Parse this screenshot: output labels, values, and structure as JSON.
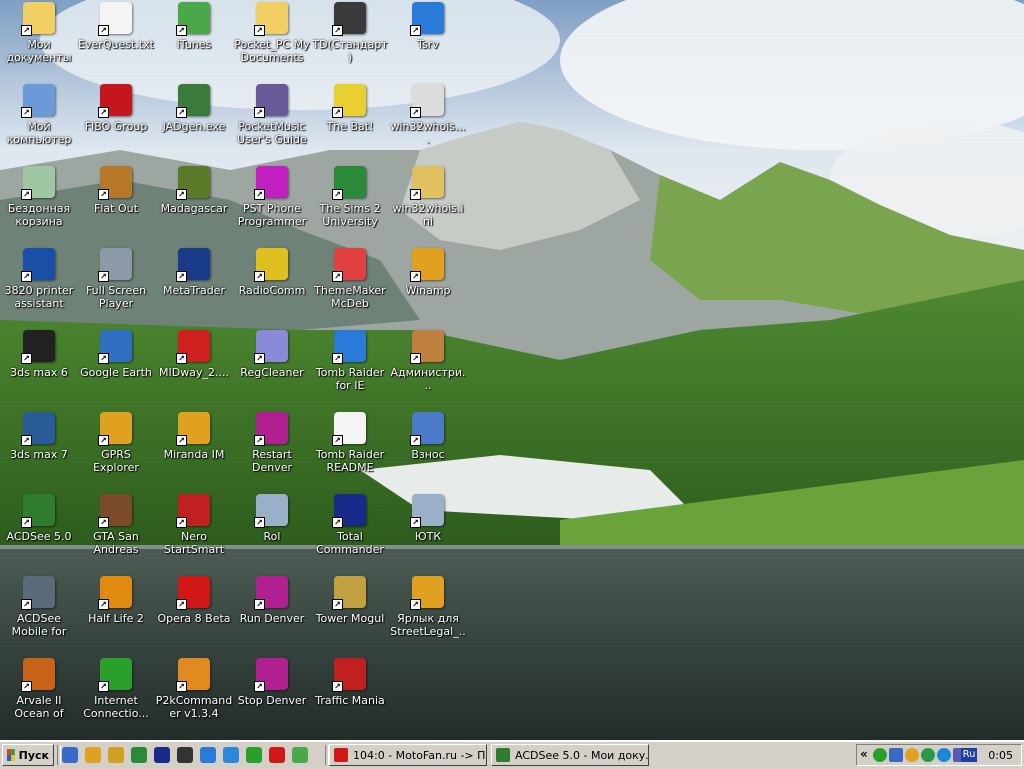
{
  "desktop": {
    "icons": [
      {
        "label": "Мои документы",
        "icon": "my-documents-icon",
        "color": "#f2cf62"
      },
      {
        "label": "Мой компьютер",
        "icon": "my-computer-icon",
        "color": "#6a9ad8"
      },
      {
        "label": "Бездонная корзина",
        "icon": "recycle-bin-icon",
        "color": "#9fc7a3"
      },
      {
        "label": "3820 printer assistant",
        "icon": "hp-printer-icon",
        "color": "#1a4fa8"
      },
      {
        "label": "3ds max 6",
        "icon": "3dsmax-icon",
        "color": "#222222"
      },
      {
        "label": "3ds max 7",
        "icon": "3dsmax-icon",
        "color": "#2a5b99"
      },
      {
        "label": "ACDSee 5.0",
        "icon": "acdsee-icon",
        "color": "#2f7b2f"
      },
      {
        "label": "ACDSee Mobile for Windows...",
        "icon": "acdsee-mobile-icon",
        "color": "#5a6b7a"
      },
      {
        "label": "Arvale II Ocean of Time",
        "icon": "game-icon",
        "color": "#c7641a"
      },
      {
        "label": "EverQuest.txt",
        "icon": "text-file-icon",
        "color": "#f4f4f4"
      },
      {
        "label": "FIBO Group",
        "icon": "fibo-icon",
        "color": "#c4161c"
      },
      {
        "label": "Flat Out",
        "icon": "flatout-icon",
        "color": "#b8782a"
      },
      {
        "label": "Full Screen Player",
        "icon": "media-player-icon",
        "color": "#8c9aa8"
      },
      {
        "label": "Google Earth",
        "icon": "globe-icon",
        "color": "#2f6fc4"
      },
      {
        "label": "GPRS Explorer",
        "icon": "phone-icon",
        "color": "#e0a020"
      },
      {
        "label": "GTA San Andreas",
        "icon": "game-icon",
        "color": "#7a4a2a"
      },
      {
        "label": "Half Life 2",
        "icon": "halflife-icon",
        "color": "#e08a10"
      },
      {
        "label": "Internet Connectio...",
        "icon": "network-icon",
        "color": "#2aa02a"
      },
      {
        "label": "iTunes",
        "icon": "itunes-icon",
        "color": "#4aa84a"
      },
      {
        "label": "JADgen.exe",
        "icon": "exe-icon",
        "color": "#3a7a3a"
      },
      {
        "label": "Madagascar",
        "icon": "game-icon",
        "color": "#5a7a2a"
      },
      {
        "label": "MetaTrader",
        "icon": "chart-icon",
        "color": "#1a3a8a"
      },
      {
        "label": "MIDway_2....",
        "icon": "arrows-icon",
        "color": "#d02020"
      },
      {
        "label": "Miranda IM",
        "icon": "miranda-icon",
        "color": "#e0a020"
      },
      {
        "label": "Nero StartSmart",
        "icon": "nero-icon",
        "color": "#c02020"
      },
      {
        "label": "Opera 8 Beta",
        "icon": "opera-icon",
        "color": "#d01818"
      },
      {
        "label": "P2kCommander v1.3.4",
        "icon": "gear-icon",
        "color": "#e08a20"
      },
      {
        "label": "Pocket_PC My Documents",
        "icon": "folder-icon",
        "color": "#f2cf62"
      },
      {
        "label": "PocketMusic User's Guide",
        "icon": "help-icon",
        "color": "#6a5a9a"
      },
      {
        "label": "PST Phone Programmer",
        "icon": "tetris-icon",
        "color": "#c020c0"
      },
      {
        "label": "RadioComm",
        "icon": "radio-icon",
        "color": "#e0c020"
      },
      {
        "label": "RegCleaner",
        "icon": "cleaner-icon",
        "color": "#8a8ad8"
      },
      {
        "label": "Restart Denver",
        "icon": "denver-icon",
        "color": "#b02090"
      },
      {
        "label": "Rol",
        "icon": "network-icon",
        "color": "#9ab0c8"
      },
      {
        "label": "Run Denver",
        "icon": "denver-icon",
        "color": "#b02090"
      },
      {
        "label": "Stop Denver",
        "icon": "denver-icon",
        "color": "#b02090"
      },
      {
        "label": "TD(Стандарт)",
        "icon": "terminal-icon",
        "color": "#3a3a3a"
      },
      {
        "label": "The Bat!",
        "icon": "bat-icon",
        "color": "#e8d030"
      },
      {
        "label": "The Sims 2 University",
        "icon": "sims-icon",
        "color": "#2a8a3a"
      },
      {
        "label": "ThemeMaker McDeb",
        "icon": "theme-icon",
        "color": "#e04040"
      },
      {
        "label": "Tomb Raider for IE",
        "icon": "ie-icon",
        "color": "#2a7ad8"
      },
      {
        "label": "Tomb Raider README",
        "icon": "text-file-icon",
        "color": "#f4f4f4"
      },
      {
        "label": "Total Commander",
        "icon": "floppy-icon",
        "color": "#1a2a8a"
      },
      {
        "label": "Tower Mogul",
        "icon": "building-icon",
        "color": "#c0a040"
      },
      {
        "label": "Traffic Mania",
        "icon": "traffic-icon",
        "color": "#c02020"
      },
      {
        "label": "Tsrv",
        "icon": "network-icon",
        "color": "#2a7ad8"
      },
      {
        "label": "win32whois....",
        "icon": "exe-icon",
        "color": "#dcdcdc"
      },
      {
        "label": "win32whois.ini",
        "icon": "ini-file-icon",
        "color": "#e0c060"
      },
      {
        "label": "Winamp",
        "icon": "winamp-icon",
        "color": "#e0a020"
      },
      {
        "label": "Администри...",
        "icon": "admin-tools-icon",
        "color": "#c08040"
      },
      {
        "label": "Взнос",
        "icon": "document-icon",
        "color": "#4a7ac8"
      },
      {
        "label": "ЮТК",
        "icon": "network-icon",
        "color": "#9ab0c8"
      },
      {
        "label": "Ярлык для StreetLegal_...",
        "icon": "car-icon",
        "color": "#e0a020"
      }
    ]
  },
  "taskbar": {
    "start_label": "Пуск",
    "quick_launch": [
      {
        "icon": "show-desktop-icon",
        "color": "#3a6ac8"
      },
      {
        "icon": "browser-icon",
        "color": "#e0a020"
      },
      {
        "icon": "pencil-icon",
        "color": "#d0a020"
      },
      {
        "icon": "media-icon",
        "color": "#2a8a3a"
      },
      {
        "icon": "floppy-icon",
        "color": "#1a2a8a"
      },
      {
        "icon": "film-icon",
        "color": "#333333"
      },
      {
        "icon": "ie-icon",
        "color": "#2a7ad8"
      },
      {
        "icon": "globe-icon",
        "color": "#2a8ad8"
      },
      {
        "icon": "green-circle-icon",
        "color": "#2aa02a"
      },
      {
        "icon": "opera-icon",
        "color": "#d01818"
      },
      {
        "icon": "itunes-icon",
        "color": "#4aa84a"
      }
    ],
    "tasks": [
      {
        "label": "104:0 - MotoFan.ru -> П...",
        "icon": "opera-icon",
        "color": "#d01818"
      },
      {
        "label": "ACDSee 5.0 - Мои доку...",
        "icon": "acdsee-icon",
        "color": "#2f7b2f"
      }
    ],
    "tray": {
      "expand_label": "«",
      "lang": "Ru",
      "clock": "0:05"
    }
  }
}
